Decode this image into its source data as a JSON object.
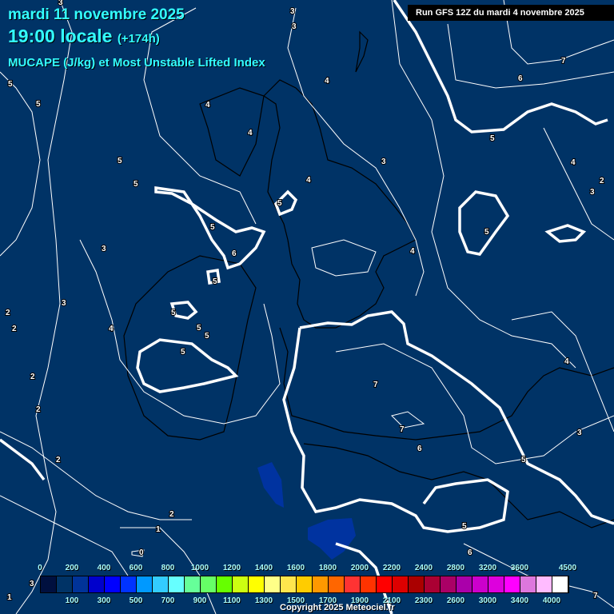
{
  "header": {
    "date": "mardi 11 novembre 2025",
    "time": "19:00 locale",
    "lead": "(+174h)",
    "parameter": "MUCAPE (J/kg) et Most Unstable Lifted Index",
    "run": "Run GFS 12Z du mardi 4 novembre 2025"
  },
  "colors": {
    "background": "#003366",
    "contour": "#ffffff",
    "coastline": "#000000",
    "cape_shade": "#0033a0"
  },
  "contour_labels": [
    "3",
    "3",
    "3",
    "7",
    "6",
    "5",
    "4",
    "4",
    "4",
    "5",
    "5",
    "2",
    "3",
    "4",
    "5",
    "5",
    "5",
    "3",
    "6",
    "5",
    "4",
    "3",
    "5",
    "5",
    "5",
    "5",
    "5",
    "5",
    "4",
    "2",
    "2",
    "2",
    "2",
    "3",
    "4",
    "7",
    "7",
    "6",
    "5",
    "4",
    "3",
    "5",
    "2",
    "2",
    "1",
    "0",
    "6",
    "3",
    "1",
    "7"
  ],
  "scale": {
    "colors": [
      "#00103f",
      "#003366",
      "#003399",
      "#0000cc",
      "#0000ff",
      "#0033ff",
      "#0099ff",
      "#33ccff",
      "#66ffff",
      "#66ff99",
      "#66ff66",
      "#66ff00",
      "#ccff11",
      "#ffff00",
      "#ffff88",
      "#ffe64d",
      "#ffcc00",
      "#ff9900",
      "#ff6600",
      "#ff3333",
      "#ff3300",
      "#ff0000",
      "#dd0000",
      "#aa0000",
      "#aa0033",
      "#aa0066",
      "#aa00aa",
      "#cc00cc",
      "#dd00dd",
      "#ff00ff",
      "#dd77dd",
      "#ffbbff",
      "#ffffff"
    ],
    "top_labels": [
      "0",
      "200",
      "400",
      "600",
      "800",
      "1000",
      "1200",
      "1400",
      "1600",
      "1800",
      "2000",
      "2200",
      "2400",
      "2800",
      "3200",
      "3600",
      "4500"
    ],
    "bottom_labels": [
      "100",
      "300",
      "500",
      "700",
      "900",
      "1100",
      "1300",
      "1500",
      "1700",
      "1900",
      "2100",
      "2300",
      "2600",
      "3000",
      "3400",
      "4000"
    ]
  },
  "footer": {
    "copyright": "Copyright 2025 Meteociel.fr"
  }
}
